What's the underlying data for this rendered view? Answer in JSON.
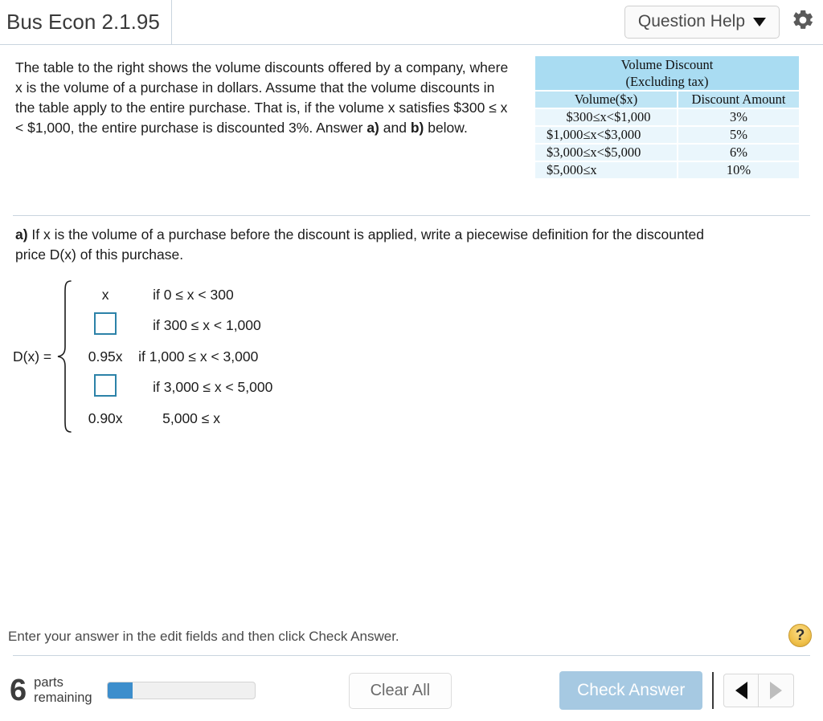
{
  "header": {
    "title": "Bus Econ 2.1.95",
    "question_help_label": "Question Help",
    "settings_icon": "gear-icon",
    "caret_icon": "chevron-down-icon"
  },
  "problem": {
    "text_line1": "The table to the right shows the volume discounts offered by a",
    "text_line2": "company, where x is the volume of a purchase in dollars. Assume that",
    "text_line3": "the volume discounts in the table apply to the entire purchase. That is,",
    "text_line4": "if the volume x satisfies $300 ≤ x < $1,000, the entire purchase is",
    "text_line5_pre": "discounted 3%. Answer ",
    "text_line5_a": "a)",
    "text_line5_mid": " and ",
    "text_line5_b": "b)",
    "text_line5_post": " below."
  },
  "table": {
    "title_line1": "Volume Discount",
    "title_line2": "(Excluding tax)",
    "columns": [
      "Volume($x)",
      "Discount Amount"
    ],
    "rows": [
      {
        "volume": "$300≤x<$1,000",
        "discount": "3%"
      },
      {
        "volume": "$1,000≤x<$3,000",
        "discount": "5%"
      },
      {
        "volume": "$3,000≤x<$5,000",
        "discount": "6%"
      },
      {
        "volume": "$5,000≤x",
        "discount": "10%"
      }
    ],
    "header_color": "#a9dcf2",
    "column_header_color": "#bfe5f5",
    "row_color": "#eaf6fc"
  },
  "part_a": {
    "label": "a)",
    "line1": " If x is the volume of a purchase before the discount is applied, write a piecewise definition for the discounted",
    "line2": "price D(x) of this purchase."
  },
  "piecewise": {
    "function_label": "D(x) =",
    "pieces": [
      {
        "value": "x",
        "value_type": "text",
        "condition": "if 0 ≤ x < 300"
      },
      {
        "value": "",
        "value_type": "input",
        "condition": "if 300 ≤ x < 1,000"
      },
      {
        "value": "0.95x",
        "value_type": "text",
        "condition": "if 1,000 ≤ x < 3,000"
      },
      {
        "value": "",
        "value_type": "input",
        "condition": "if 3,000 ≤ x < 5,000"
      },
      {
        "value": "0.90x",
        "value_type": "text",
        "condition": "5,000 ≤ x"
      }
    ],
    "input_border_color": "#2c82a8"
  },
  "footer": {
    "hint": "Enter your answer in the edit fields and then click Check Answer.",
    "help_icon_label": "?",
    "parts_count": "6",
    "parts_label_line1": "parts",
    "parts_label_line2": "remaining",
    "progress_percent": 17,
    "progress_fill_color": "#3d8ecc",
    "clear_all_label": "Clear All",
    "check_answer_label": "Check Answer",
    "check_answer_color": "#a6c9e2",
    "prev_icon": "triangle-left-icon",
    "next_icon": "triangle-right-icon"
  }
}
